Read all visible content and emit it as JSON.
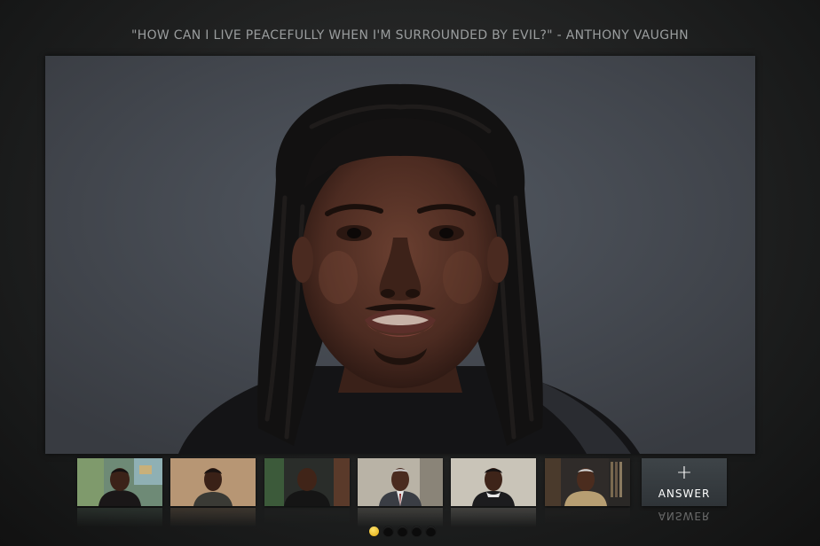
{
  "question": {
    "title": "\"HOW CAN I LIVE PEACEFULLY WHEN I'M SURROUNDED BY EVIL?\" - ANTHONY VAUGHN"
  },
  "video": {
    "subject": "person speaking to camera"
  },
  "thumbnails": [
    {
      "name": "answer-video-1"
    },
    {
      "name": "answer-video-2"
    },
    {
      "name": "answer-video-3"
    },
    {
      "name": "answer-video-4"
    },
    {
      "name": "answer-video-5"
    },
    {
      "name": "answer-video-6"
    }
  ],
  "answer_button": {
    "icon": "plus-icon",
    "plus": "+",
    "label": "ANSWER"
  },
  "pager": {
    "count": 5,
    "active_index": 0
  },
  "colors": {
    "active_dot": "#f0c020",
    "title_text": "#9a9d9e"
  }
}
